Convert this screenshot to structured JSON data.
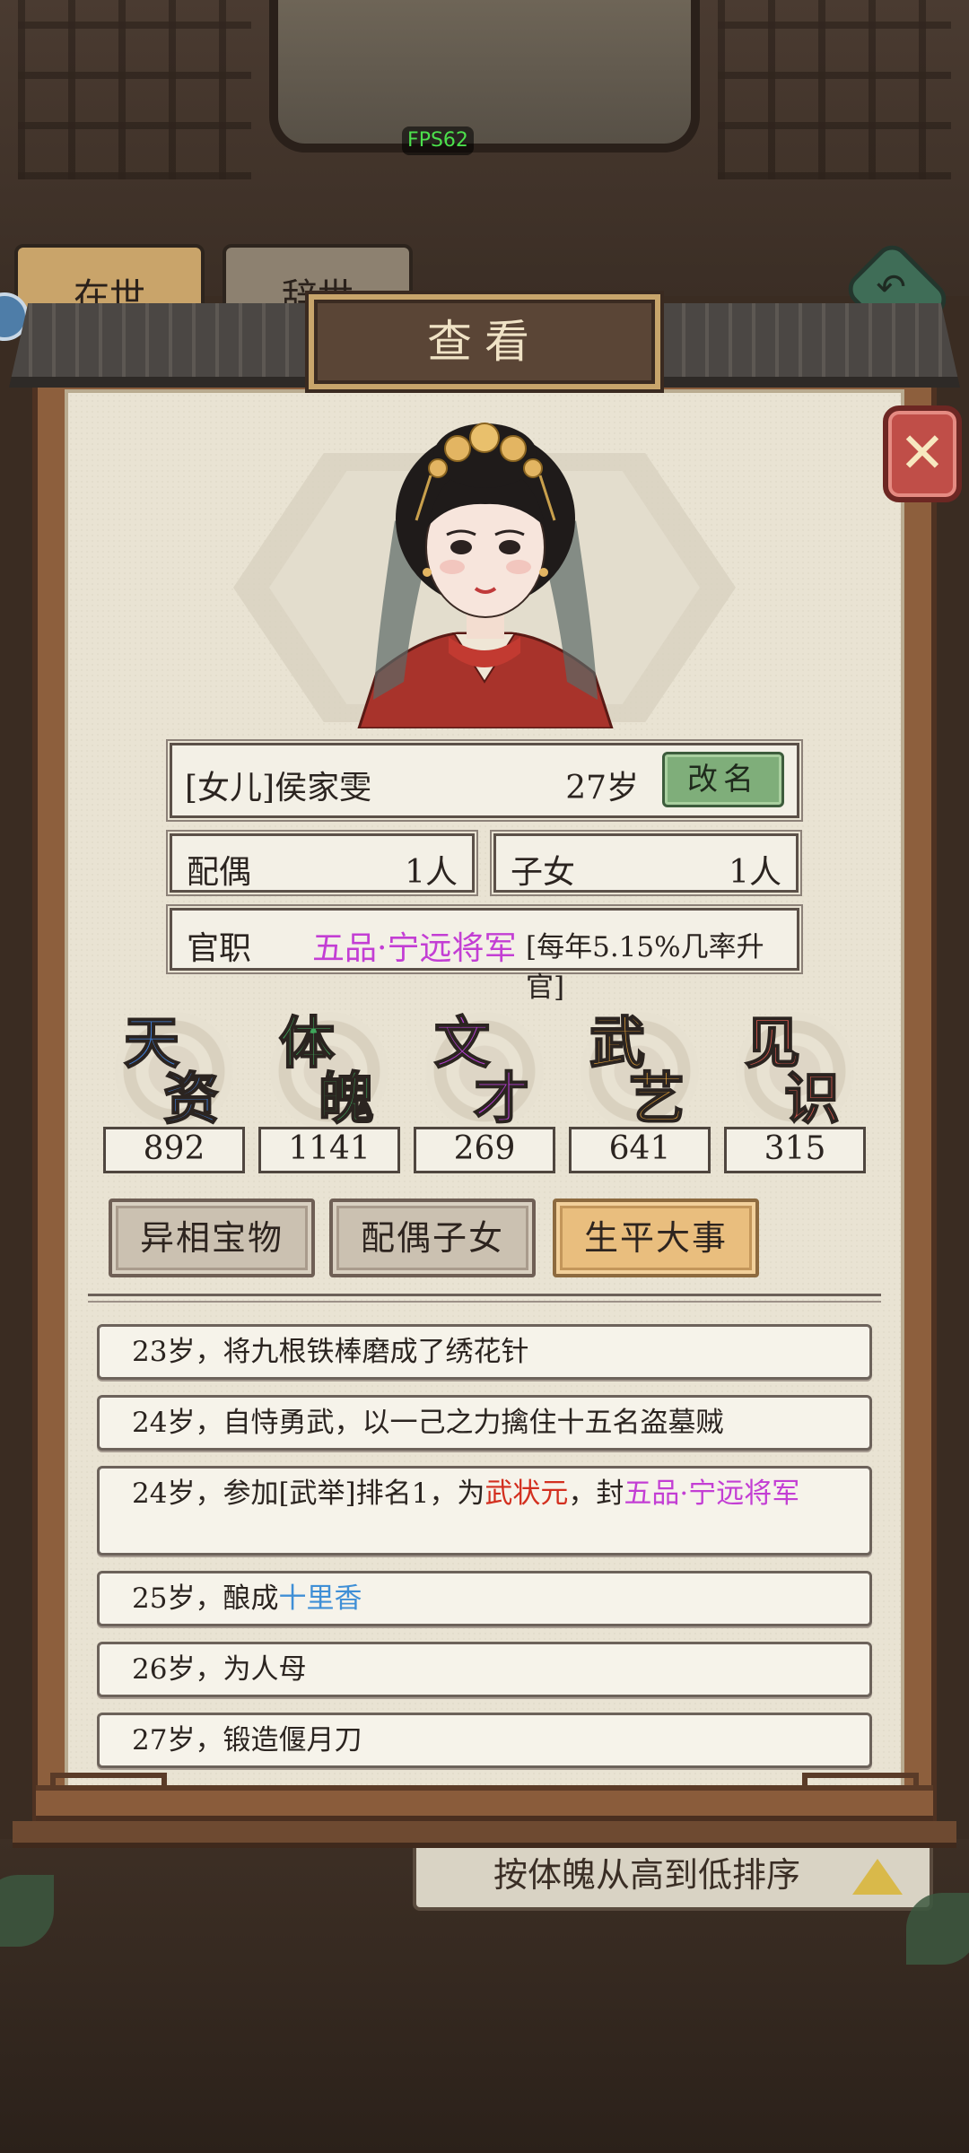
{
  "fps": "FPS62",
  "background": {
    "tab_alive": "在世",
    "tab_dead": "辞世",
    "sort_label": "按体魄从高到低排序"
  },
  "dialog": {
    "title": "查看",
    "close_label": "✕"
  },
  "character": {
    "name": "[女儿]侯家雯",
    "age": "27岁",
    "rename_label": "改名",
    "spouse_label": "配偶",
    "spouse_count": "1人",
    "children_label": "子女",
    "children_count": "1人",
    "office_label": "官职",
    "office_value": "五品·宁远将军",
    "office_promotion": "[每年5.15%几率升官]"
  },
  "attributes": [
    {
      "name": "天资",
      "c1": "天",
      "c2": "资",
      "value": "892",
      "color": "#3f7fd9"
    },
    {
      "name": "体魄",
      "c1": "体",
      "c2": "魄",
      "value": "1141",
      "color": "#3fa75b"
    },
    {
      "name": "文才",
      "c1": "文",
      "c2": "才",
      "value": "269",
      "color": "#b63fd3"
    },
    {
      "name": "武艺",
      "c1": "武",
      "c2": "艺",
      "value": "641",
      "color": "#e3a13a"
    },
    {
      "name": "见识",
      "c1": "见",
      "c2": "识",
      "value": "315",
      "color": "#d2574e"
    }
  ],
  "tabs": [
    {
      "label": "异相宝物",
      "active": false
    },
    {
      "label": "配偶子女",
      "active": false
    },
    {
      "label": "生平大事",
      "active": true
    }
  ],
  "events": [
    {
      "text": "23岁，将九根铁棒磨成了绣花针"
    },
    {
      "text": "24岁，自恃勇武，以一己之力擒住十五名盗墓贼"
    },
    {
      "prefix": "24岁，参加[武举]排名1，为",
      "highlight_red": "武状元",
      "mid": "，封",
      "highlight_pink": "五品·宁远将军"
    },
    {
      "prefix": "25岁，酿成",
      "highlight_blue": "十里香"
    },
    {
      "text": "26岁，为人母"
    },
    {
      "text": "27岁，锻造偃月刀"
    }
  ]
}
